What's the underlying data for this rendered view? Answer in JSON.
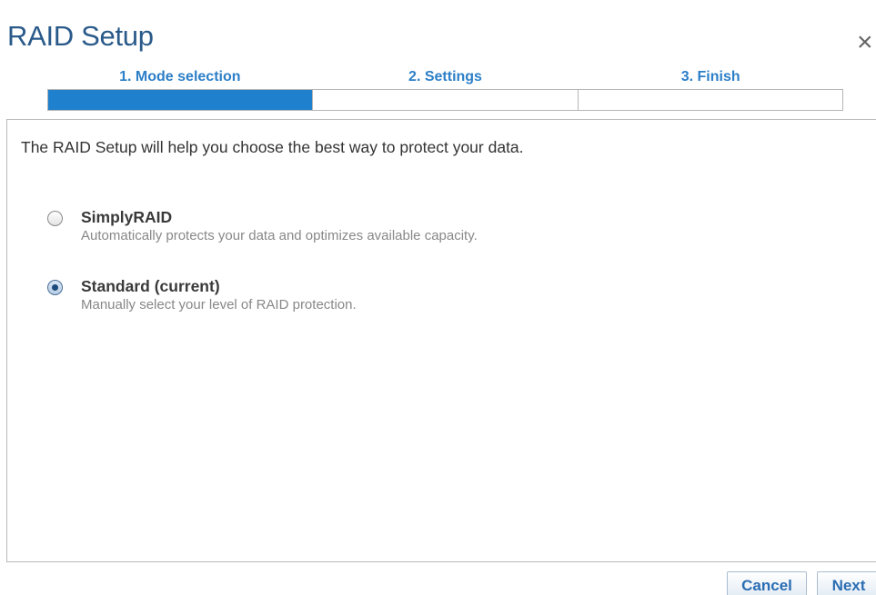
{
  "dialog": {
    "title": "RAID Setup",
    "close_glyph": "×"
  },
  "steps": [
    {
      "label": "1. Mode selection",
      "active": true
    },
    {
      "label": "2. Settings",
      "active": false
    },
    {
      "label": "3. Finish",
      "active": false
    }
  ],
  "content": {
    "intro": "The RAID Setup will help you choose the best way to protect your data.",
    "options": [
      {
        "title": "SimplyRAID",
        "description": "Automatically protects your data and optimizes available capacity.",
        "selected": false
      },
      {
        "title": "Standard (current)",
        "description": "Manually select your level of RAID protection.",
        "selected": true
      }
    ]
  },
  "footer": {
    "cancel_label": "Cancel",
    "next_label": "Next"
  },
  "colors": {
    "accent": "#1f80cd",
    "title": "#2a5a8a",
    "step_label": "#2c7fc8"
  }
}
